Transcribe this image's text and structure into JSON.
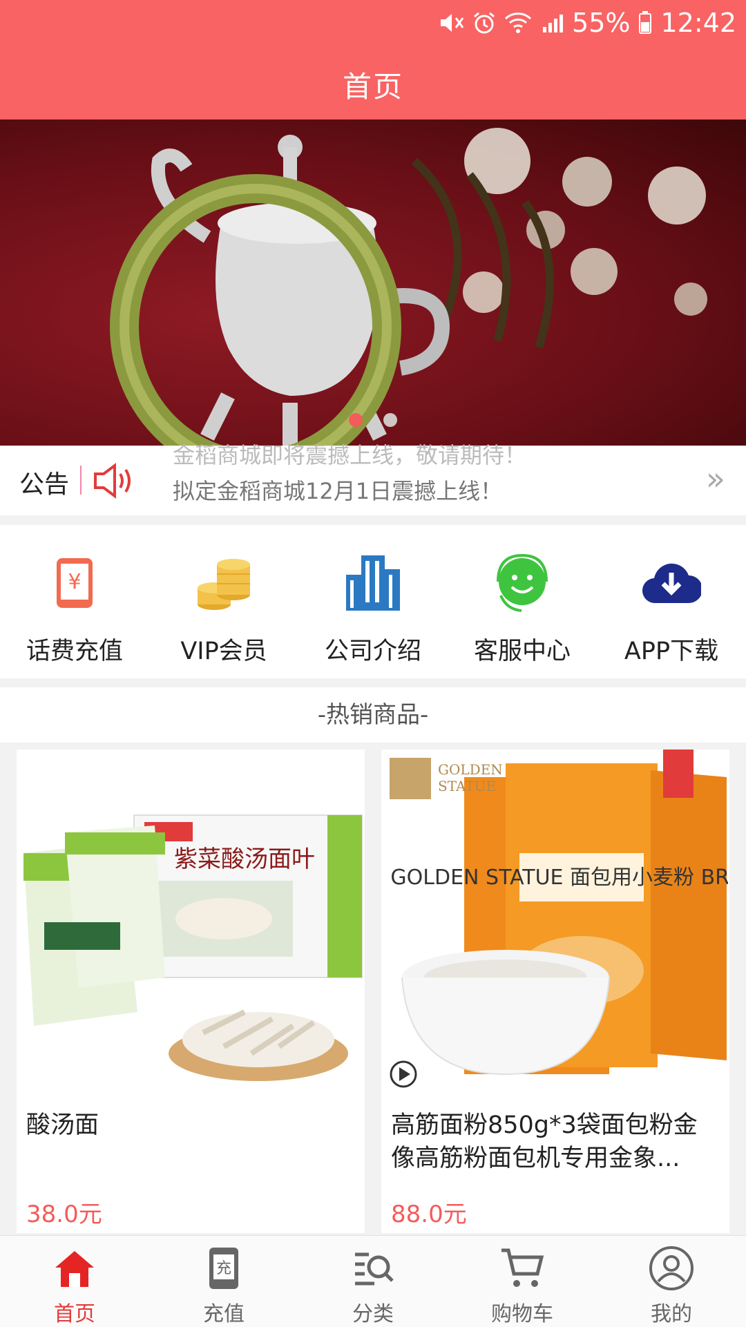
{
  "status_bar": {
    "battery": "55%",
    "time": "12:42"
  },
  "header": {
    "title": "首页"
  },
  "notice": {
    "label": "公告",
    "prev_text": "金稻商城即将震撼上线，敬请期待！",
    "text": "拟定金稻商城12月1日震撼上线！"
  },
  "nav": [
    {
      "label": "话费充值",
      "icon": "phone-yuan-icon"
    },
    {
      "label": "VIP会员",
      "icon": "coins-icon"
    },
    {
      "label": "公司介绍",
      "icon": "building-icon"
    },
    {
      "label": "客服中心",
      "icon": "support-agent-icon"
    },
    {
      "label": "APP下载",
      "icon": "cloud-download-icon"
    }
  ],
  "hot_title": "-热销商品-",
  "products": [
    {
      "name": "酸汤面",
      "price": "38.0元",
      "image_text": "紫菜酸汤面叶"
    },
    {
      "name": "高筋面粉850g*3袋面包粉金像高筋粉面包机专用金象...",
      "price": "88.0元",
      "image_text": "GOLDEN STATUE 面包用小麦粉 BREAD"
    }
  ],
  "banner": {
    "slide_count": 2,
    "active_slide": 1
  },
  "tabbar": [
    {
      "label": "首页",
      "icon": "home-icon",
      "active": true
    },
    {
      "label": "充值",
      "icon": "recharge-icon",
      "active": false
    },
    {
      "label": "分类",
      "icon": "category-icon",
      "active": false
    },
    {
      "label": "购物车",
      "icon": "cart-icon",
      "active": false
    },
    {
      "label": "我的",
      "icon": "profile-icon",
      "active": false
    }
  ],
  "colors": {
    "header": "#f96363",
    "accent": "#f45b5b",
    "price": "#f45b5b"
  }
}
